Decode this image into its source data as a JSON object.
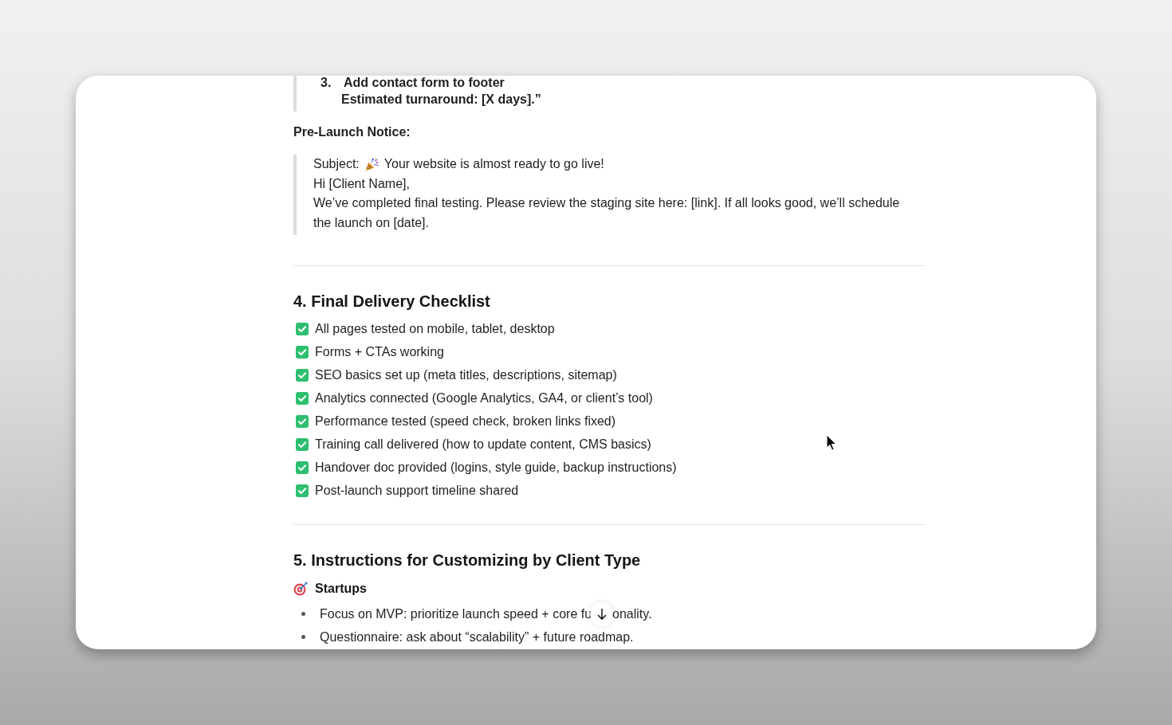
{
  "quote_top": {
    "list_number": "3.",
    "item": "Add contact form to footer",
    "continuation": "Estimated turnaround: [X days].”"
  },
  "pre_launch_notice": {
    "heading": "Pre-Launch Notice:",
    "subject_label": "Subject:",
    "subject": "Your website is almost ready to go live!",
    "greeting": "Hi [Client Name],",
    "body": "We’ve completed final testing. Please review the staging site here: [link]. If all looks good, we’ll schedule the launch on [date]."
  },
  "checklist_section": {
    "title": "4. Final Delivery Checklist",
    "items": [
      {
        "text": "All pages tested on mobile, tablet, desktop",
        "checked": true
      },
      {
        "text": "Forms + CTAs working",
        "checked": true
      },
      {
        "text": "SEO basics set up (meta titles, descriptions, sitemap)",
        "checked": true
      },
      {
        "text": "Analytics connected (Google Analytics, GA4, or client’s tool)",
        "checked": true
      },
      {
        "text": "Performance tested (speed check, broken links fixed)",
        "checked": true
      },
      {
        "text": "Training call delivered (how to update content, CMS basics)",
        "checked": true
      },
      {
        "text": "Handover doc provided (logins, style guide, backup instructions)",
        "checked": true
      },
      {
        "text": "Post-launch support timeline shared",
        "checked": true
      }
    ]
  },
  "customizing_section": {
    "title": "5. Instructions for Customizing by Client Type",
    "subsection": {
      "title": "Startups",
      "bullets": [
        {
          "text": "Focus on MVP: prioritize launch speed + core fu",
          "text_continued": "onality."
        },
        {
          "text": "Questionnaire: ask about “scalability” + future roadmap."
        }
      ]
    }
  }
}
